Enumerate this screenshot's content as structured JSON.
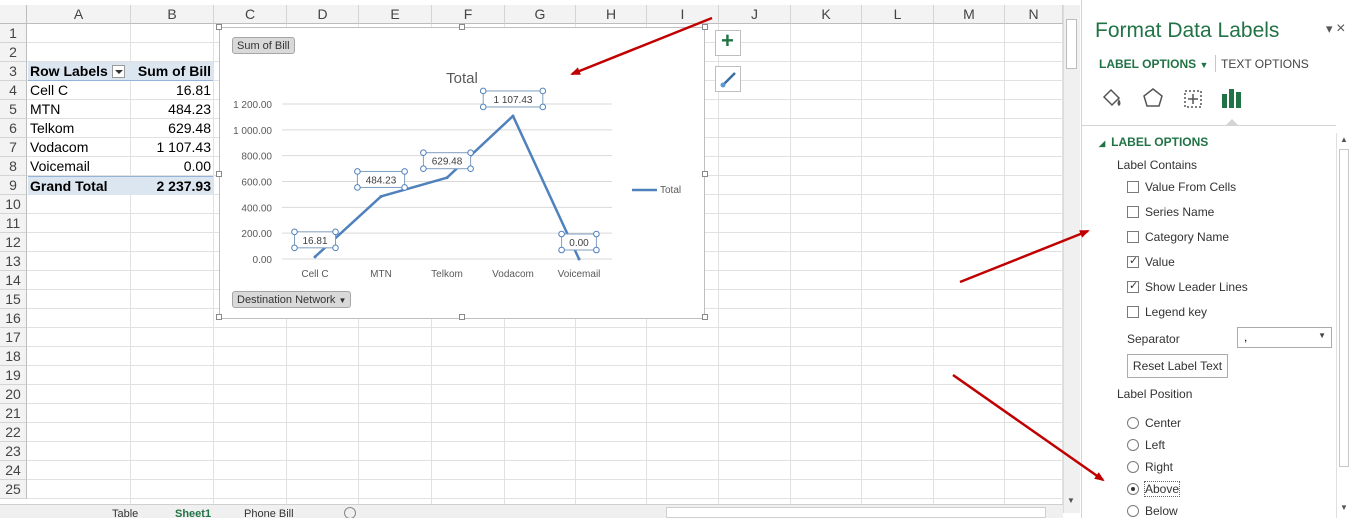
{
  "sheet": {
    "columns": [
      "A",
      "B",
      "C",
      "D",
      "E",
      "F",
      "G",
      "H",
      "I",
      "J",
      "K",
      "L",
      "M",
      "N"
    ],
    "rows": [
      "1",
      "2",
      "3",
      "4",
      "5",
      "6",
      "7",
      "8",
      "9",
      "10",
      "11",
      "12",
      "13",
      "14",
      "15",
      "16",
      "17",
      "18",
      "19",
      "20",
      "21",
      "22",
      "23",
      "24",
      "25"
    ],
    "tabs": [
      "Table",
      "Sheet1",
      "Phone Bill"
    ]
  },
  "pivot": {
    "row_labels_header": "Row Labels",
    "sum_header": "Sum of Bill",
    "rows": [
      {
        "label": "Cell C",
        "value": "16.81"
      },
      {
        "label": "MTN",
        "value": "484.23"
      },
      {
        "label": "Telkom",
        "value": "629.48"
      },
      {
        "label": "Vodacom",
        "value": "1 107.43"
      },
      {
        "label": "Voicemail",
        "value": "0.00"
      }
    ],
    "grand_total_label": "Grand Total",
    "grand_total_value": "2 237.93"
  },
  "chart_data": {
    "type": "line",
    "title": "Total",
    "field_button_top": "Sum of Bill",
    "field_button_bottom": "Destination Network",
    "categories": [
      "Cell C",
      "MTN",
      "Telkom",
      "Vodacom",
      "Voicemail"
    ],
    "series": [
      {
        "name": "Total",
        "values": [
          16.81,
          484.23,
          629.48,
          1107.43,
          0.0
        ],
        "color": "#4f81bd"
      }
    ],
    "data_labels": [
      "16.81",
      "484.23",
      "629.48",
      "1 107.43",
      "0.00"
    ],
    "y_ticks": [
      "0.00",
      "200.00",
      "400.00",
      "600.00",
      "800.00",
      "1 000.00",
      "1 200.00"
    ],
    "ylim": [
      0,
      1200
    ],
    "legend_position": "right",
    "grid": true
  },
  "panel": {
    "title": "Format Data Labels",
    "tab_label_options": "LABEL OPTIONS",
    "tab_text_options": "TEXT OPTIONS",
    "section_title": "LABEL OPTIONS",
    "label_contains": "Label Contains",
    "checkboxes": [
      {
        "label": "Value From Cells",
        "checked": false
      },
      {
        "label": "Series Name",
        "checked": false
      },
      {
        "label": "Category Name",
        "checked": false
      },
      {
        "label": "Value",
        "checked": true
      },
      {
        "label": "Show Leader Lines",
        "checked": true
      },
      {
        "label": "Legend key",
        "checked": false
      }
    ],
    "separator_label": "Separator",
    "separator_value": ",",
    "reset_button": "Reset Label Text",
    "label_position": "Label Position",
    "radios": [
      {
        "label": "Center",
        "selected": false
      },
      {
        "label": "Left",
        "selected": false
      },
      {
        "label": "Right",
        "selected": false
      },
      {
        "label": "Above",
        "selected": true
      },
      {
        "label": "Below",
        "selected": false
      }
    ]
  },
  "colors": {
    "accent": "#217346",
    "series": "#4f81bd",
    "annotation_arrow": "#c00000",
    "pivot_fill": "#dce6f1"
  }
}
